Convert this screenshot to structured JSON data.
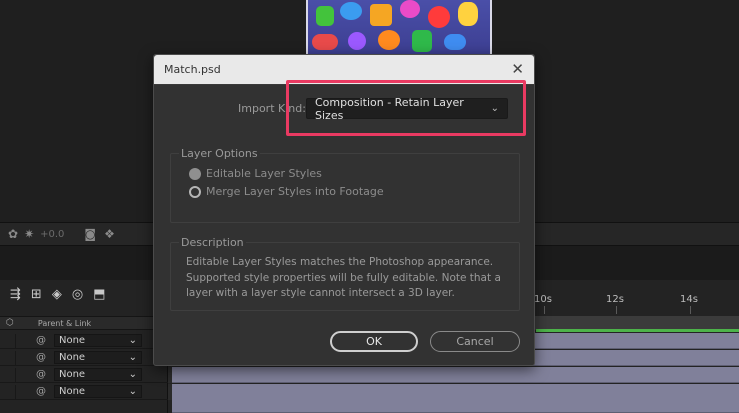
{
  "dialog": {
    "title": "Match.psd",
    "import_kind_label": "Import Kind:",
    "import_kind_value": "Composition - Retain Layer Sizes",
    "layer_options": {
      "legend": "Layer Options",
      "options": [
        "Editable Layer Styles",
        "Merge Layer Styles into Footage"
      ],
      "selected": "Editable Layer Styles"
    },
    "description": {
      "legend": "Description",
      "text": "Editable Layer Styles matches the Photoshop appearance. Supported style properties will be fully editable. Note that a layer with a layer style cannot intersect a 3D layer."
    },
    "ok_label": "OK",
    "cancel_label": "Cancel",
    "highlight_color": "#ea3a62"
  },
  "viewer": {
    "exposure": "+0.0"
  },
  "timeline": {
    "column_header": "Parent & Link",
    "ruler_labels": [
      "10s",
      "12s",
      "14s"
    ],
    "layers": [
      {
        "parent": "None"
      },
      {
        "parent": "None"
      },
      {
        "parent": "None"
      },
      {
        "parent": "None"
      }
    ],
    "track_color": "#80809a",
    "work_area_color": "#4db34a"
  }
}
